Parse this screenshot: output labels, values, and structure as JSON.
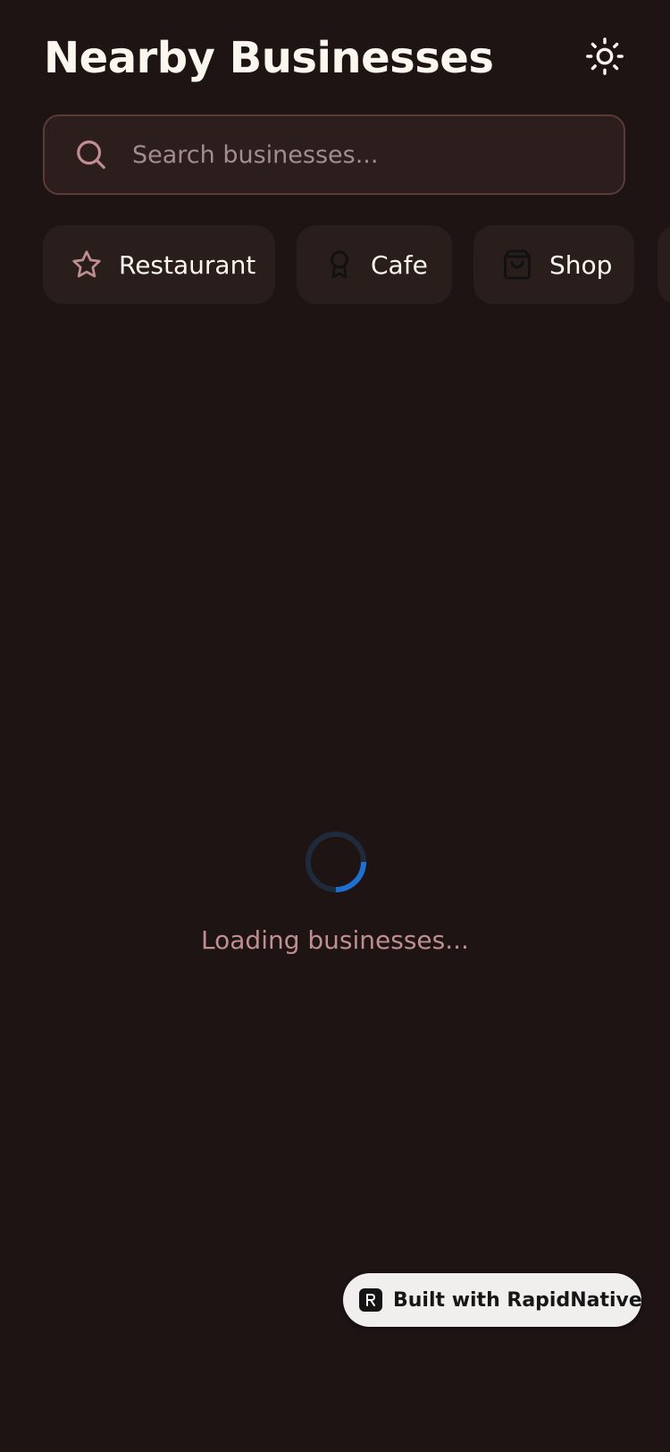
{
  "header": {
    "title": "Nearby Businesses",
    "theme_toggle_icon": "sun-icon"
  },
  "search": {
    "placeholder": "Search businesses...",
    "value": "",
    "icon": "search-icon"
  },
  "categories": [
    {
      "label": "Restaurant",
      "icon": "star-icon"
    },
    {
      "label": "Cafe",
      "icon": "award-icon"
    },
    {
      "label": "Shop",
      "icon": "shopping-bag-icon"
    }
  ],
  "loading": {
    "text": "Loading businesses...",
    "progress": 0.25
  },
  "badge": {
    "label": "Built with RapidNative",
    "icon": "rapidnative-logo-icon"
  },
  "colors": {
    "background": "#1d1413",
    "surface": "#2a1e1d",
    "search_border": "#5a3b38",
    "accent_icon": "#c08e90",
    "spinner_track": "#1f2a3a",
    "spinner_active": "#1f6fd1",
    "text_primary": "#fbf7ef",
    "text_muted": "#a18e8c"
  }
}
